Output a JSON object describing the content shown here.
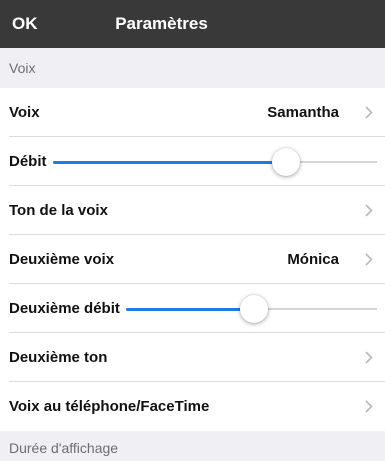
{
  "navbar": {
    "ok_label": "OK",
    "title": "Paramètres"
  },
  "sections": {
    "voice_header": "Voix",
    "display_header": "Durée d'affichage"
  },
  "rows": {
    "voice": {
      "label": "Voix",
      "value": "Samantha"
    },
    "rate": {
      "label": "Débit",
      "level": 0.72
    },
    "pitch": {
      "label": "Ton de la voix"
    },
    "second_voice": {
      "label": "Deuxième voix",
      "value": "Mónica"
    },
    "second_rate": {
      "label": "Deuxième débit",
      "level": 0.51
    },
    "second_pitch": {
      "label": "Deuxième ton"
    },
    "facetime": {
      "label": "Voix au téléphone/FaceTime"
    }
  },
  "icons": {
    "chevron": "chevron-right-icon"
  },
  "colors": {
    "navbar": "#393939",
    "accent": "#1f7ce6",
    "section_bg": "#efeff4"
  }
}
